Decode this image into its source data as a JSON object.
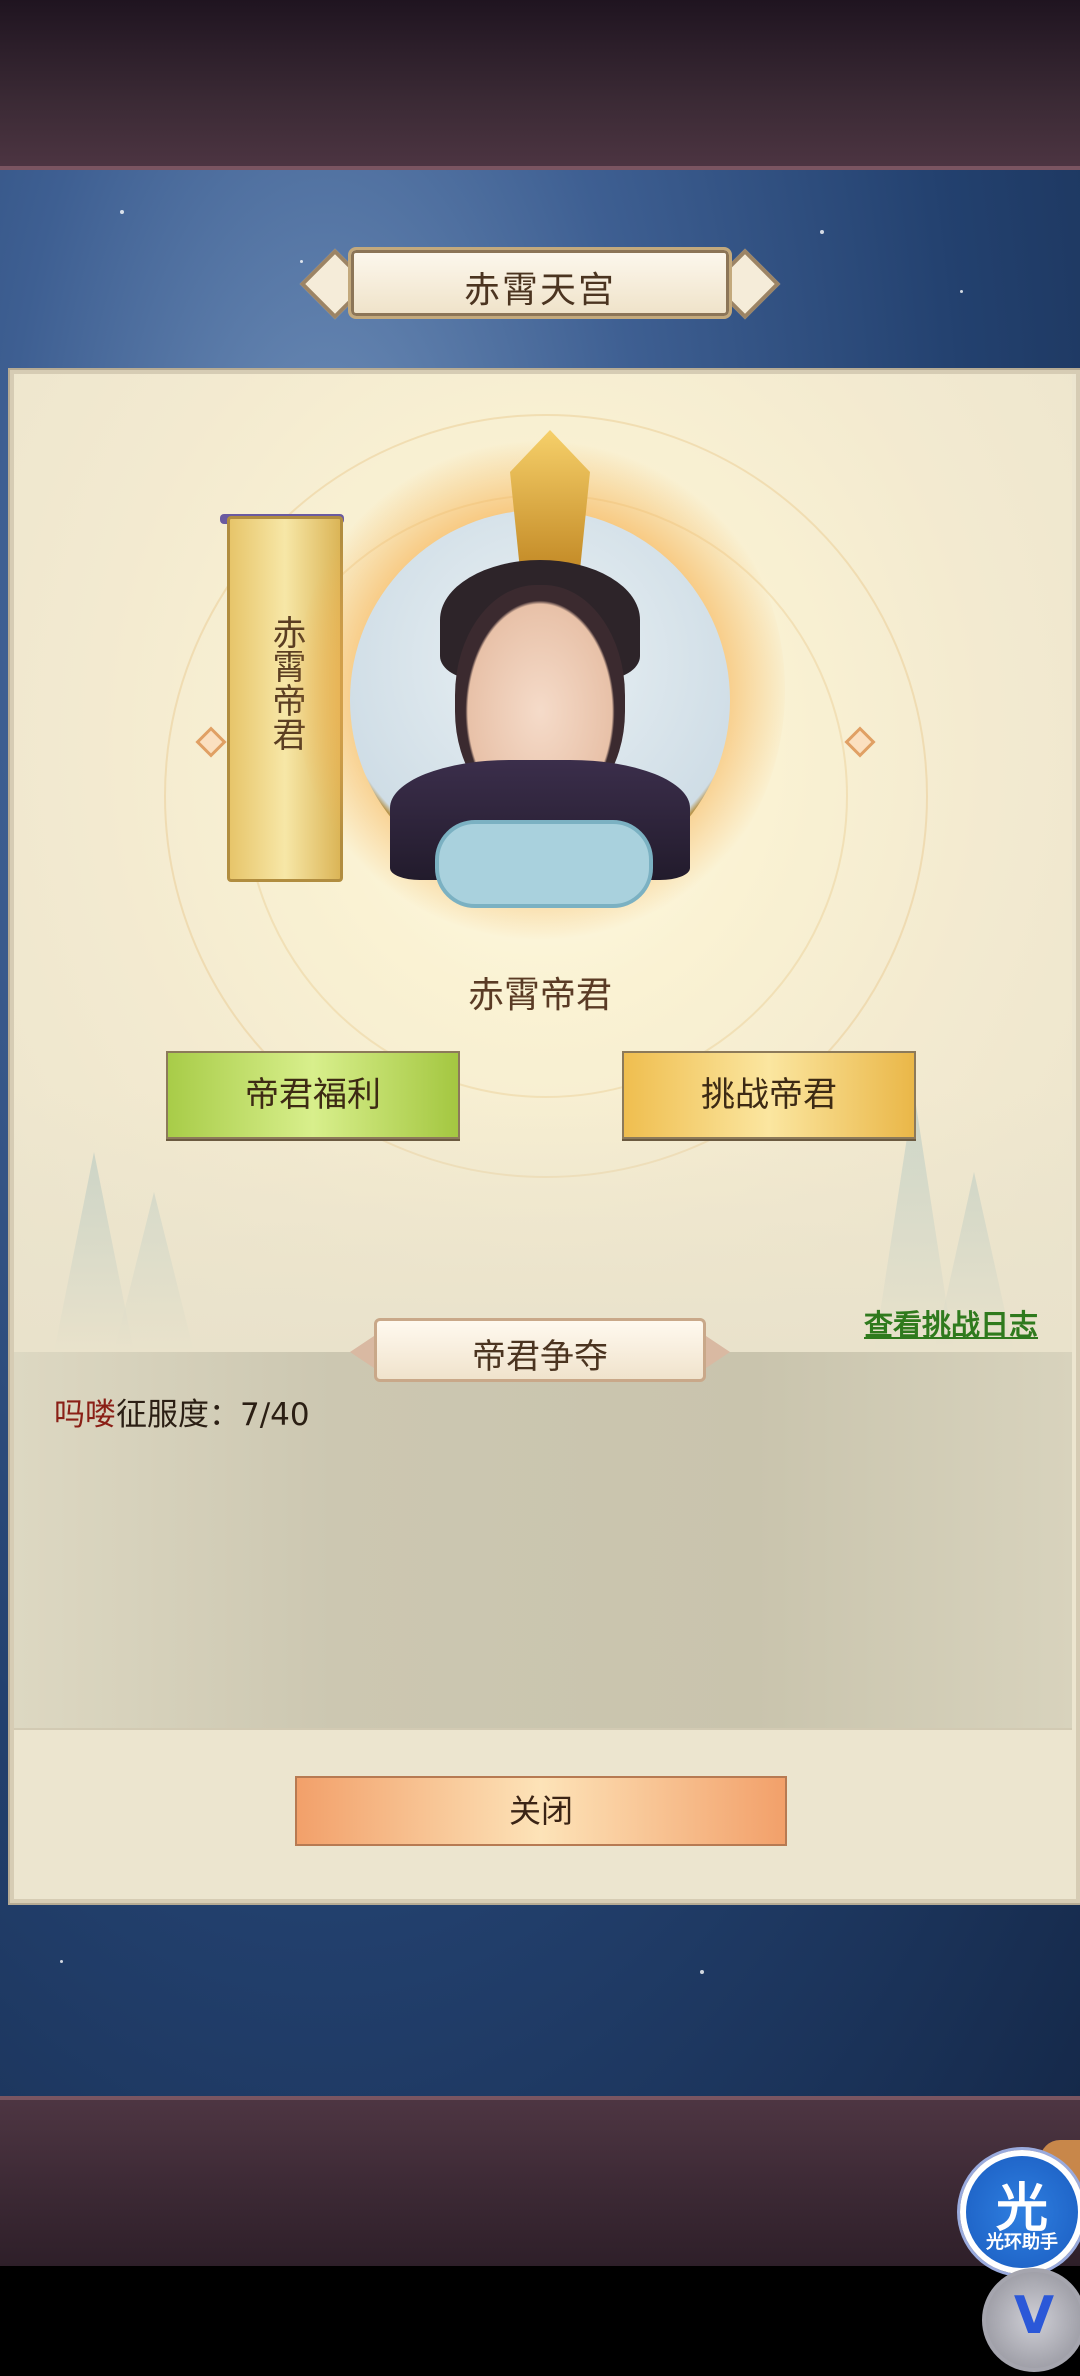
{
  "title": "赤霄天宫",
  "banner_text": "赤霄帝君",
  "hero_name": "赤霄帝君",
  "buttons": {
    "welfare": "帝君福利",
    "challenge": "挑战帝君",
    "close": "关闭"
  },
  "log_link": "查看挑战日志",
  "section_title": "帝君争夺",
  "conquest": {
    "player": "吗喽",
    "label": "征服度：",
    "value": "7/40"
  },
  "assistant": {
    "glyph": "光",
    "label": "光环助手"
  },
  "v_button_glyph": "V",
  "colors": {
    "accent_red": "#8a1f16",
    "link_green": "#2f7a1d",
    "welfare_green": "#a8cc48",
    "challenge_gold": "#efbe4f",
    "close_orange": "#f2a06a"
  },
  "icons": [
    "portrait-emperor-icon",
    "assistant-icon",
    "v-icon"
  ]
}
